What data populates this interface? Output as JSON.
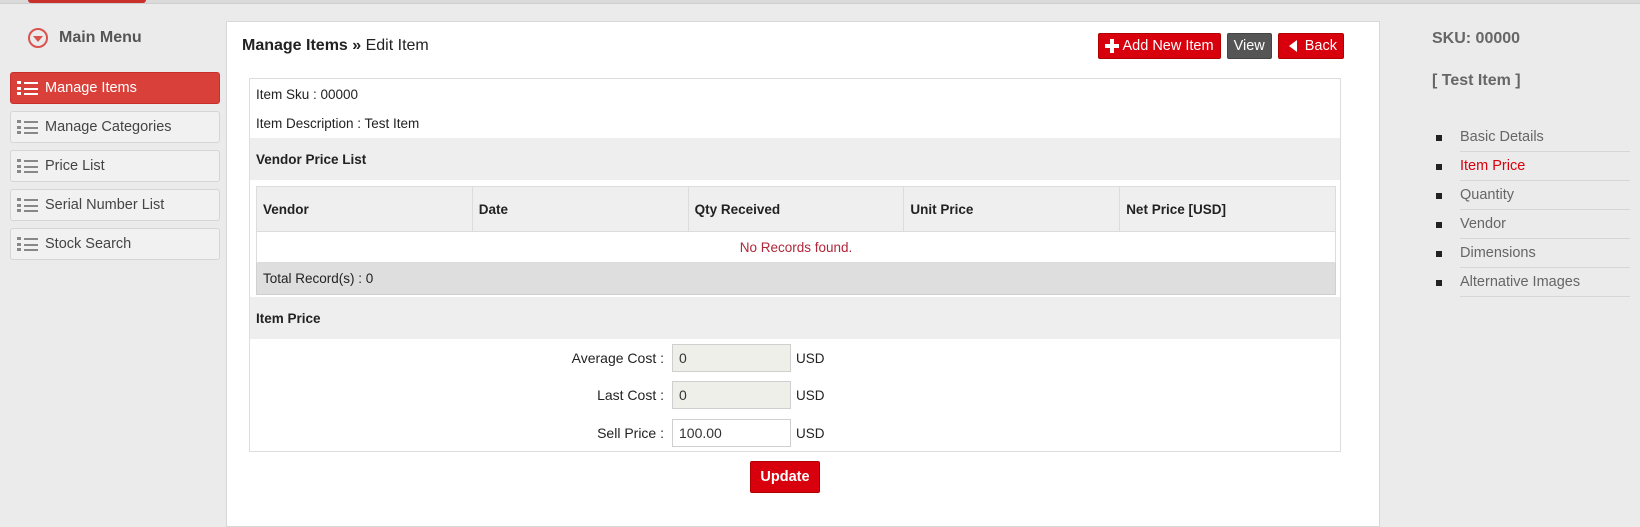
{
  "sidebar": {
    "title": "Main Menu",
    "items": [
      {
        "label": "Manage Items",
        "active": true
      },
      {
        "label": "Manage Categories"
      },
      {
        "label": "Price List"
      },
      {
        "label": "Serial Number List"
      },
      {
        "label": "Stock Search"
      }
    ]
  },
  "header": {
    "section": "Manage Items",
    "separator": " » ",
    "page": "Edit Item",
    "buttons": {
      "add": "Add New Item",
      "view": "View",
      "back": "Back"
    }
  },
  "item": {
    "sku_line": "Item Sku : 00000",
    "description_line": "Item Description : Test Item"
  },
  "vendor_price_list": {
    "title": "Vendor Price List",
    "columns": [
      "Vendor",
      "Date",
      "Qty Received",
      "Unit Price",
      "Net Price [USD]"
    ],
    "empty_message": "No Records found.",
    "total_label": "Total Record(s) :  0"
  },
  "item_price": {
    "title": "Item Price",
    "average_cost": {
      "label": "Average Cost :",
      "value": "0",
      "unit": "USD"
    },
    "last_cost": {
      "label": "Last Cost :",
      "value": "0",
      "unit": "USD"
    },
    "sell_price": {
      "label": "Sell Price :",
      "value": "100.00",
      "unit": "USD"
    }
  },
  "update_label": "Update",
  "right_panel": {
    "sku": "SKU: 00000",
    "item_name": "[ Test Item ]",
    "nav": [
      {
        "label": "Basic Details"
      },
      {
        "label": "Item Price",
        "active": true
      },
      {
        "label": "Quantity"
      },
      {
        "label": "Vendor"
      },
      {
        "label": "Dimensions"
      },
      {
        "label": "Alternative Images"
      }
    ]
  },
  "colors": {
    "accent_red": "#d8000c",
    "active_menu": "#d9403a",
    "view_button": "#555555"
  }
}
